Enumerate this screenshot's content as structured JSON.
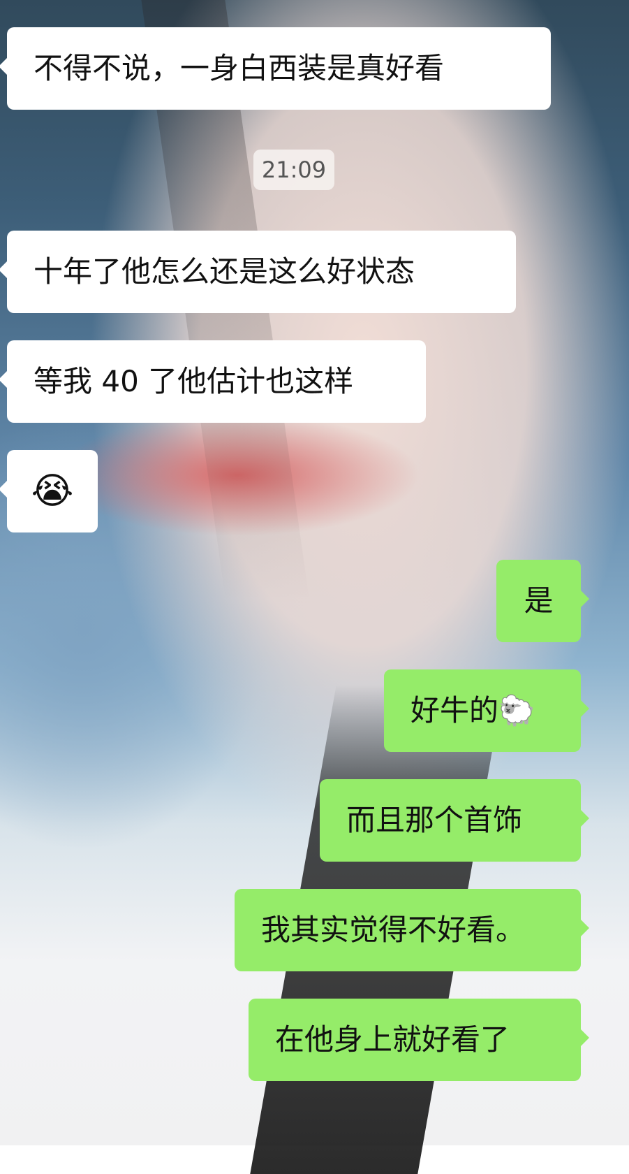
{
  "timestamp": "21:09",
  "messages": [
    {
      "side": "left",
      "text": "不得不说，一身白西装是真好看"
    },
    {
      "side": "left",
      "text": "十年了他怎么还是这么好状态"
    },
    {
      "side": "left",
      "text": "等我 40 了他估计也这样"
    },
    {
      "side": "left",
      "text": "😭"
    },
    {
      "side": "right",
      "text": "是"
    },
    {
      "side": "right",
      "text": "好牛的🐑"
    },
    {
      "side": "right",
      "text": "而且那个首饰"
    },
    {
      "side": "right",
      "text": "我其实觉得不好看。"
    },
    {
      "side": "right",
      "text": "在他身上就好看了"
    }
  ]
}
